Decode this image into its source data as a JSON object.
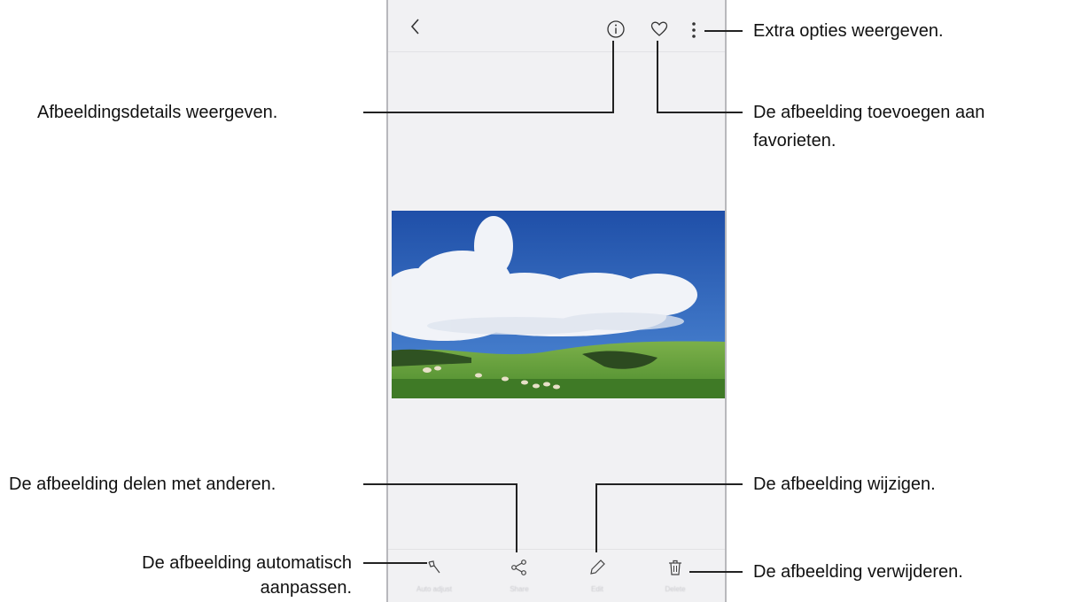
{
  "bottom_bar": {
    "items": [
      {
        "label": "Auto adjust",
        "icon": "magic-wand-icon"
      },
      {
        "label": "Share",
        "icon": "share-icon"
      },
      {
        "label": "Edit",
        "icon": "pencil-icon"
      },
      {
        "label": "Delete",
        "icon": "trash-icon"
      }
    ]
  },
  "top_bar": {
    "icons": [
      "back-chevron-icon",
      "info-icon",
      "heart-icon",
      "more-options-icon"
    ]
  },
  "callouts": {
    "more_options": "Extra opties weergeven.",
    "details": "Afbeeldingsdetails weergeven.",
    "favorite_line1": "De afbeelding toevoegen aan",
    "favorite_line2": "favorieten.",
    "share": "De afbeelding delen met anderen.",
    "edit": "De afbeelding wijzigen.",
    "auto_adjust_line1": "De afbeelding automatisch",
    "auto_adjust_line2": "aanpassen.",
    "delete": "De afbeelding verwijderen."
  },
  "colors": {
    "sky": "#2a5fb8",
    "cloud": "#f4f6fa",
    "grass": "#5f9a3c",
    "screen_bg": "#f1f1f3",
    "leader_line": "#222222"
  }
}
